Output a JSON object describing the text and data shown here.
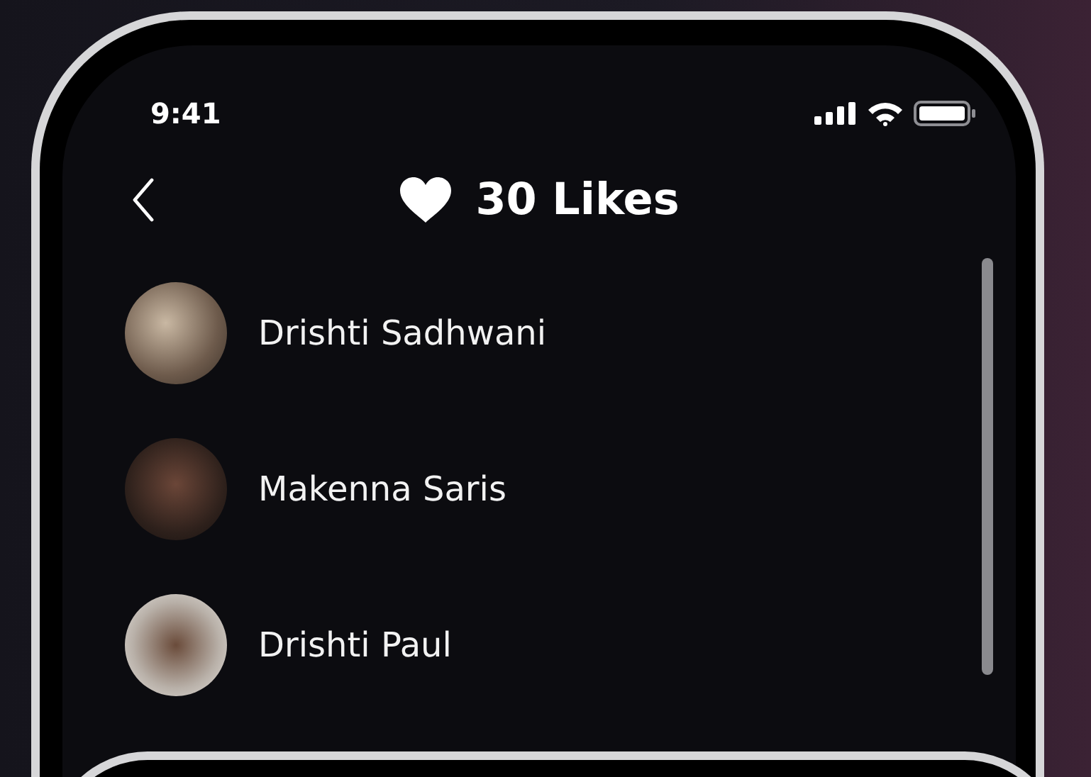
{
  "status_bar": {
    "time": "9:41"
  },
  "header": {
    "title": "30 Likes"
  },
  "likes": [
    {
      "name": "Drishti Sadhwani"
    },
    {
      "name": "Makenna Saris"
    },
    {
      "name": "Drishti Paul"
    }
  ]
}
